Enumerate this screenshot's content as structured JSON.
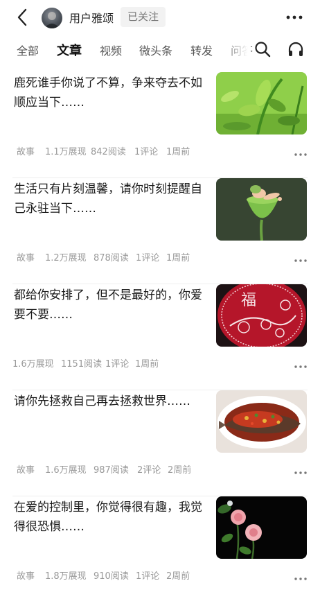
{
  "header": {
    "username": "用户雅颂",
    "follow_label": "已关注"
  },
  "tabs": [
    "全部",
    "文章",
    "视频",
    "微头条",
    "转发",
    "问答"
  ],
  "active_tab": "文章",
  "articles": [
    {
      "title": "鹿死谁手你说了不算，争来夺去不如顺应当下……",
      "category": "故事",
      "views": "1.1万展现",
      "reads": "842阅读",
      "comments": "1评论",
      "time": "1周前",
      "thumbnail": "green-plant-photo"
    },
    {
      "title": "生活只有片刻温馨，请你时刻提醒自己永驻当下……",
      "category": "故事",
      "views": "1.2万展现",
      "reads": "878阅读",
      "comments": "1评论",
      "time": "1周前",
      "thumbnail": "baby-in-lotus-pod-photo"
    },
    {
      "title": "都给你安排了，但不是最好的，你爱要不要……",
      "category": "",
      "views": "1.6万展现",
      "reads": "1151阅读",
      "comments": "1评论",
      "time": "1周前",
      "thumbnail": "fu-character-red-art"
    },
    {
      "title": "请你先拯救自己再去拯救世界……",
      "category": "故事",
      "views": "1.6万展现",
      "reads": "987阅读",
      "comments": "2评论",
      "time": "2周前",
      "thumbnail": "chili-fish-dish-photo"
    },
    {
      "title": "在爱的控制里，你觉得很有趣，我觉得很恐惧……",
      "category": "故事",
      "views": "1.8万展现",
      "reads": "910阅读",
      "comments": "1评论",
      "time": "2周前",
      "thumbnail": "pink-roses-photo"
    }
  ]
}
